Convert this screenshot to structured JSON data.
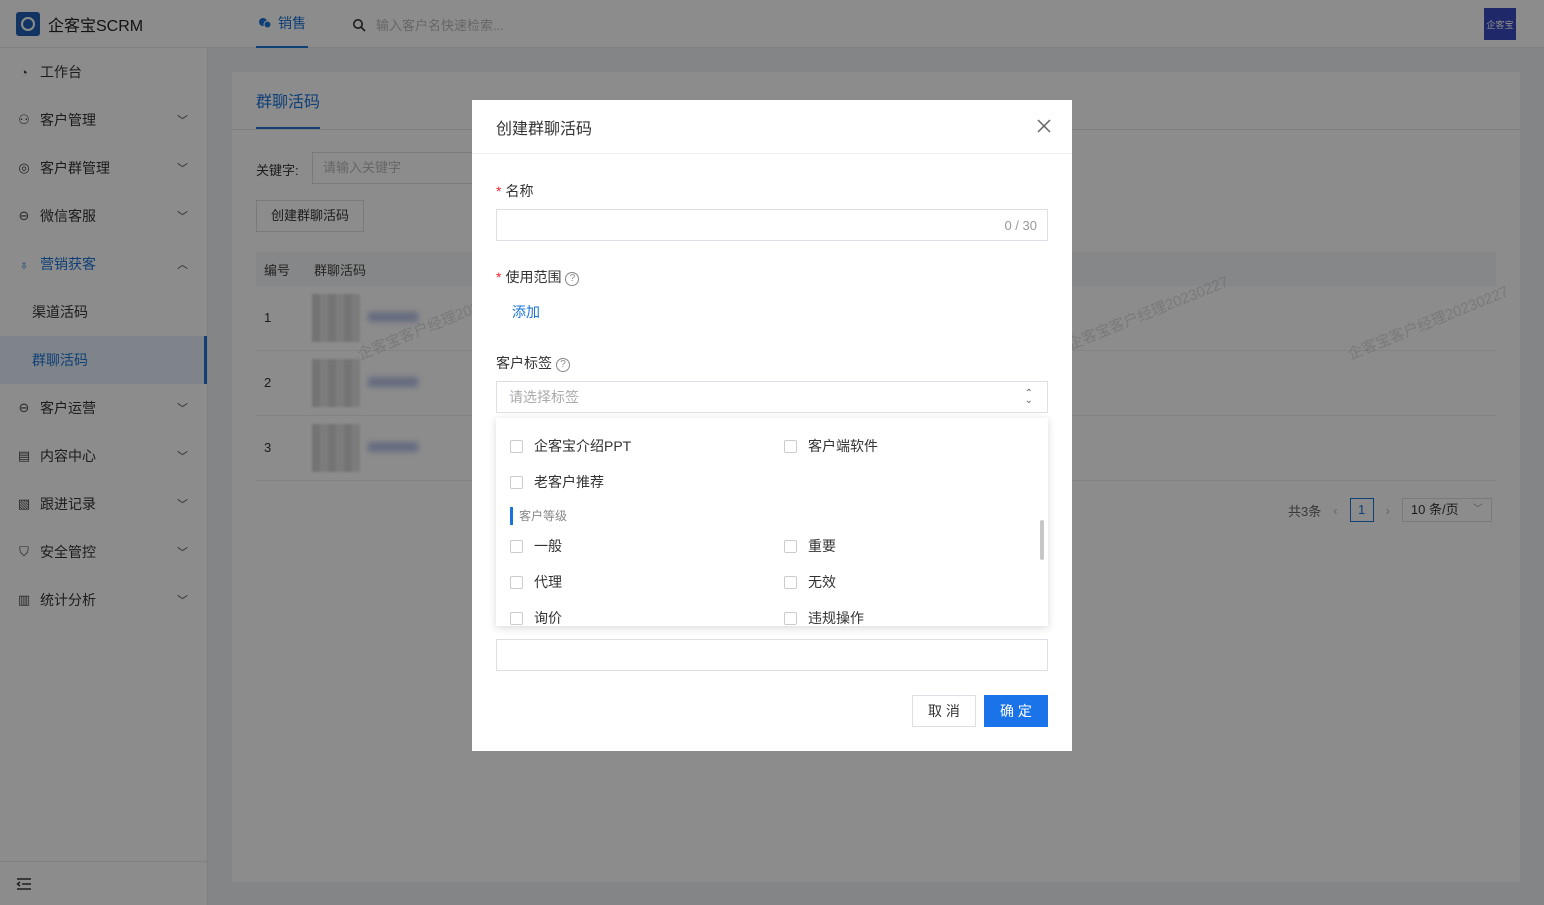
{
  "app": {
    "title": "企客宝SCRM",
    "avatar_text": "企客宝"
  },
  "topnav": {
    "active_tab": "销售",
    "search_placeholder": "输入客户名快速检索..."
  },
  "sidebar": {
    "items": [
      {
        "label": "工作台",
        "icon": "dashboard-icon"
      },
      {
        "label": "客户管理",
        "icon": "user-icon"
      },
      {
        "label": "客户群管理",
        "icon": "chat-icon"
      },
      {
        "label": "微信客服",
        "icon": "service-icon"
      },
      {
        "label": "营销获客",
        "icon": "bulb-icon"
      },
      {
        "label": "客户运营",
        "icon": "operate-icon"
      },
      {
        "label": "内容中心",
        "icon": "content-icon"
      },
      {
        "label": "跟进记录",
        "icon": "record-icon"
      },
      {
        "label": "安全管控",
        "icon": "shield-icon"
      },
      {
        "label": "统计分析",
        "icon": "chart-icon"
      }
    ],
    "sub_items": [
      "渠道活码",
      "群聊活码"
    ]
  },
  "main": {
    "tab": "群聊活码",
    "keyword_label": "关键字:",
    "keyword_placeholder": "请输入关键字",
    "create_button": "创建群聊活码",
    "columns": [
      "编号",
      "群聊活码"
    ],
    "rows": [
      "1",
      "2",
      "3"
    ],
    "watermark": "企客宝客户经理20230227",
    "pager": {
      "total": "共3条",
      "page": "1",
      "size": "10 条/页"
    }
  },
  "modal": {
    "title": "创建群聊活码",
    "name_label": "名称",
    "name_count": "0 / 30",
    "scope_label": "使用范围",
    "add_link": "添加",
    "tag_label": "客户标签",
    "tag_placeholder": "请选择标签",
    "cancel": "取 消",
    "ok": "确 定"
  },
  "dropdown": {
    "options_top": [
      "企客宝介绍PPT",
      "客户端软件",
      "老客户推荐"
    ],
    "group_title": "客户等级",
    "group_options": [
      "一般",
      "重要",
      "代理",
      "无效",
      "询价",
      "违规操作"
    ]
  },
  "colors": {
    "accent": "#1a73d9",
    "required": "#f5222d"
  }
}
